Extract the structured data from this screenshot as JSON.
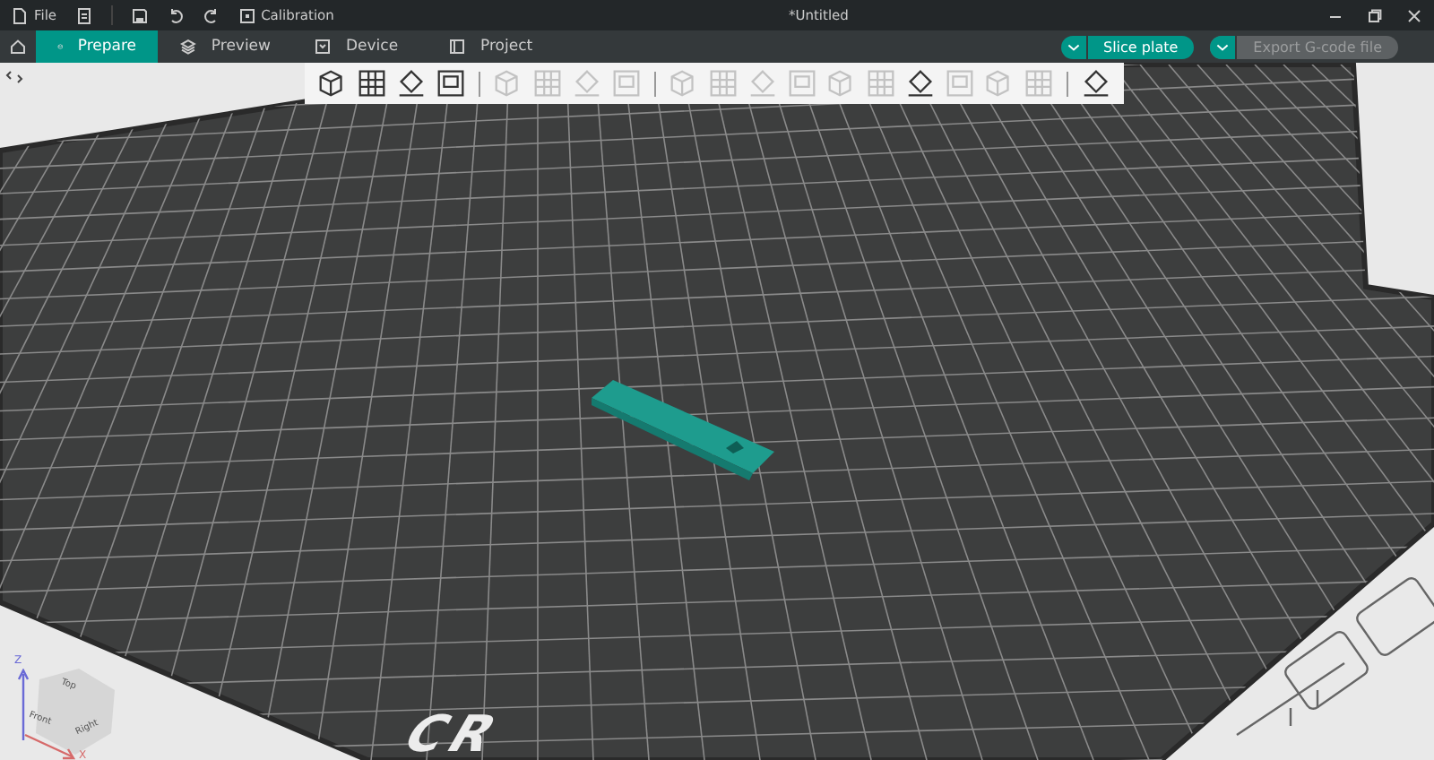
{
  "title_bar": {
    "menu_label": "File",
    "calibration_label": "Calibration",
    "document_title": "*Untitled"
  },
  "tabs": [
    {
      "label": "Prepare",
      "selected": true
    },
    {
      "label": "Preview",
      "selected": false
    },
    {
      "label": "Device",
      "selected": false
    },
    {
      "label": "Project",
      "selected": false
    }
  ],
  "actions": [
    {
      "label": "Slice plate",
      "disabled": false
    },
    {
      "label": "Export G-code file",
      "disabled": true
    }
  ],
  "toolbar": {
    "tools": [
      {
        "disabled": false
      },
      {
        "disabled": false
      },
      {
        "disabled": false
      },
      {
        "disabled": false
      },
      {
        "disabled": true
      },
      {
        "disabled": true
      },
      {
        "disabled": true
      },
      {
        "disabled": true
      },
      {
        "disabled": true
      },
      {
        "disabled": true
      },
      {
        "disabled": true
      },
      {
        "disabled": true
      },
      {
        "disabled": true
      },
      {
        "disabled": true
      },
      {
        "disabled": false
      },
      {
        "disabled": true
      },
      {
        "disabled": true
      },
      {
        "disabled": true
      },
      {
        "disabled": false
      }
    ]
  },
  "plate": {
    "logo": "CR"
  },
  "view_cube": {
    "top": "Top",
    "front": "Front",
    "right": "Right",
    "z_axis": "Z",
    "x_axis": "X"
  }
}
